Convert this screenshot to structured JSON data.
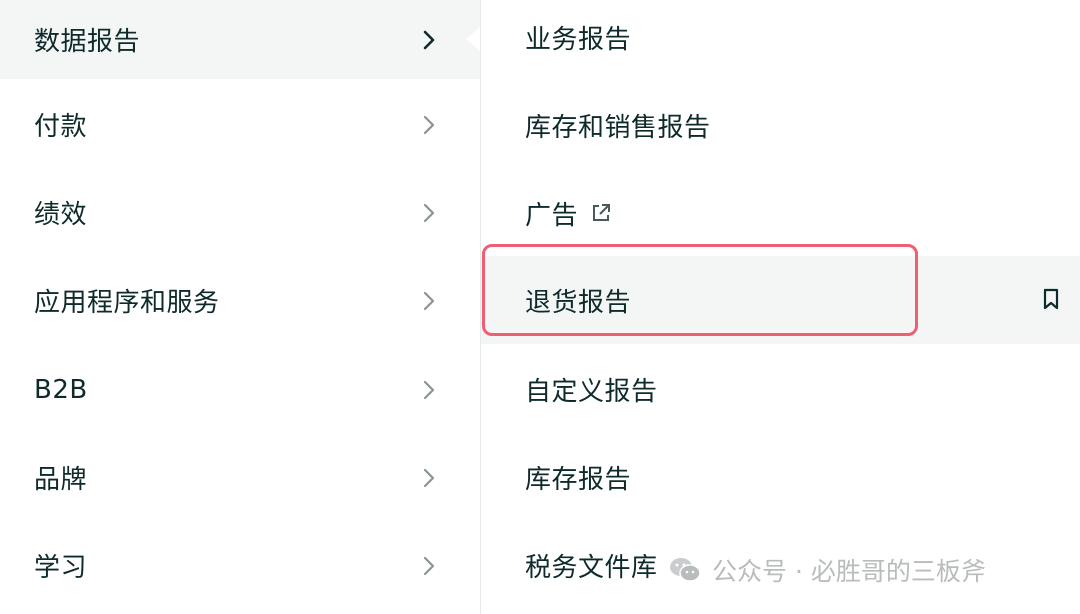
{
  "left_menu": {
    "items": [
      {
        "label": "数据报告",
        "active": true
      },
      {
        "label": "付款",
        "active": false
      },
      {
        "label": "绩效",
        "active": false
      },
      {
        "label": "应用程序和服务",
        "active": false
      },
      {
        "label": "B2B",
        "active": false
      },
      {
        "label": "品牌",
        "active": false
      },
      {
        "label": "学习",
        "active": false
      }
    ]
  },
  "submenu": {
    "items": [
      {
        "label": "业务报告"
      },
      {
        "label": "库存和销售报告"
      },
      {
        "label": "广告",
        "icon": "external-link-icon"
      },
      {
        "label": "退货报告",
        "highlighted": true,
        "icon": "bookmark-icon"
      },
      {
        "label": "自定义报告"
      },
      {
        "label": "库存报告"
      },
      {
        "label": "税务文件库"
      }
    ]
  },
  "watermark": {
    "text": "公众号 · 必胜哥的三板斧",
    "icon": "wechat-icon"
  },
  "colors": {
    "highlight_border": "#ef5f73",
    "active_bg": "#f4f6f6",
    "text": "#0f2a2a",
    "watermark": "#b8bcbd"
  }
}
